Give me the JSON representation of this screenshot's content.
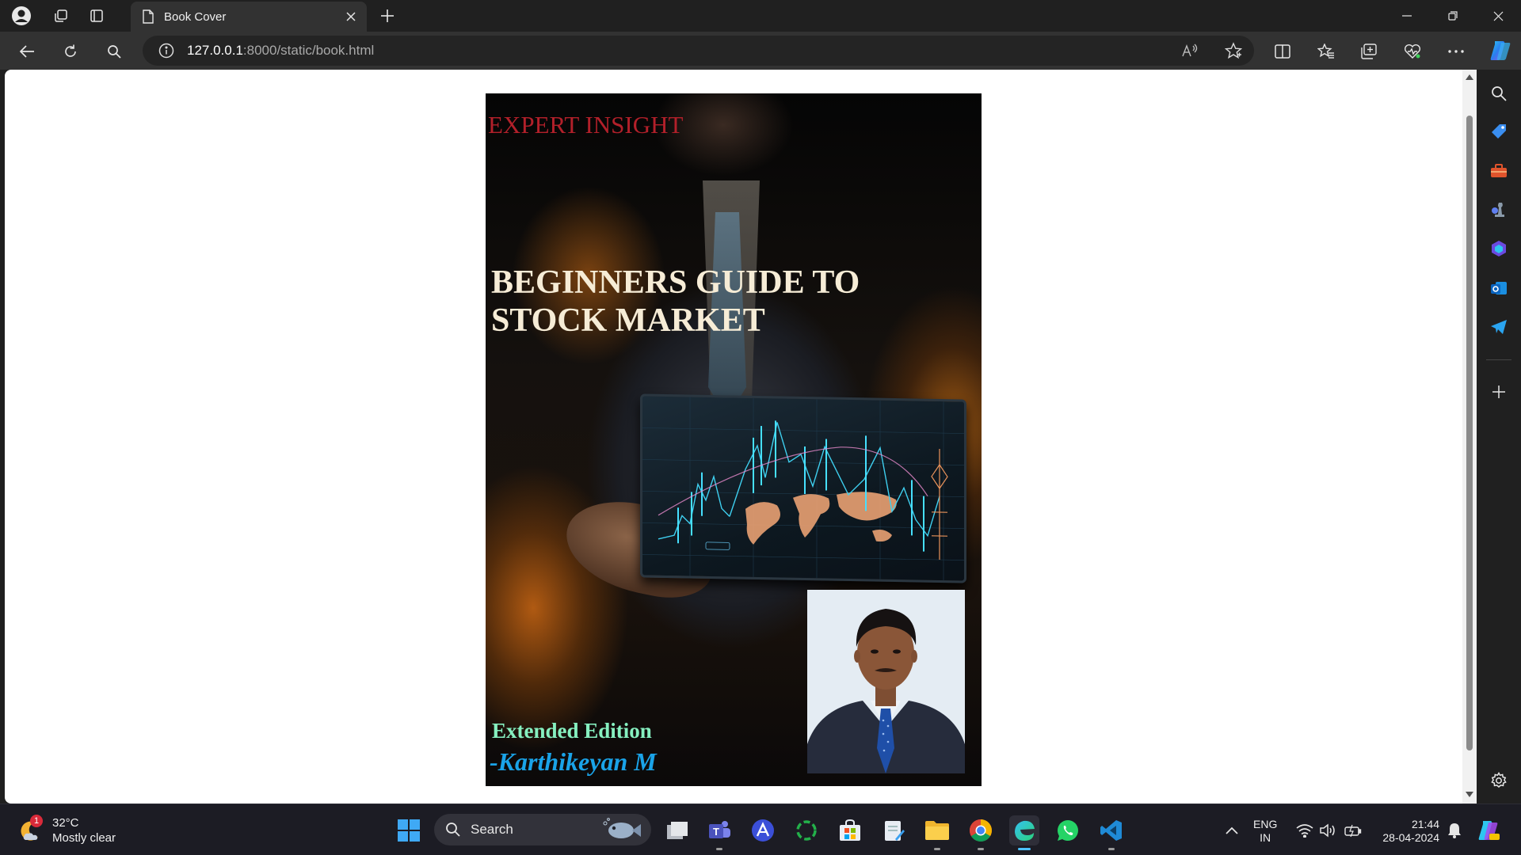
{
  "browser": {
    "tab_title": "Book Cover",
    "url_host": "127.0.0.1",
    "url_path": ":8000/static/book.html"
  },
  "book": {
    "series_label": "EXPERT INSIGHT",
    "title": "BEGINNERS GUIDE TO STOCK MARKET",
    "edition": "Extended Edition",
    "author": "-Karthikeyan M",
    "colors": {
      "series_label": "#b2202a",
      "title": "#f6ecd6",
      "edition": "#86f0c0",
      "author": "#1aa3e8"
    }
  },
  "taskbar": {
    "weather_badge": "1",
    "temperature": "32°C",
    "condition": "Mostly clear",
    "search_placeholder": "Search",
    "lang_line1": "ENG",
    "lang_line2": "IN",
    "time": "21:44",
    "date": "28-04-2024"
  },
  "icons": {
    "titlebar": [
      "profile-icon",
      "workspaces-icon",
      "tab-actions-icon",
      "page-icon",
      "close-icon",
      "plus-icon",
      "minimize-icon",
      "restore-icon",
      "window-close-icon"
    ],
    "toolbar": [
      "back-arrow-icon",
      "refresh-icon",
      "search-icon",
      "info-icon",
      "read-aloud-icon",
      "favorite-star-icon",
      "split-screen-icon",
      "favorites-icon",
      "collections-icon",
      "browser-essentials-icon",
      "more-icon",
      "copilot-icon"
    ],
    "sidebar": [
      "search-icon",
      "tag-icon",
      "toolbox-icon",
      "games-icon",
      "copilot-app-icon",
      "outlook-icon",
      "telegram-icon",
      "plus-icon",
      "settings-icon"
    ],
    "taskbar_apps": [
      "file-explorer-icon",
      "teams-icon",
      "app-icon",
      "loader-icon",
      "store-icon",
      "notepad-icon",
      "folder-icon",
      "chrome-icon",
      "edge-icon",
      "whatsapp-icon",
      "vscode-icon"
    ]
  }
}
